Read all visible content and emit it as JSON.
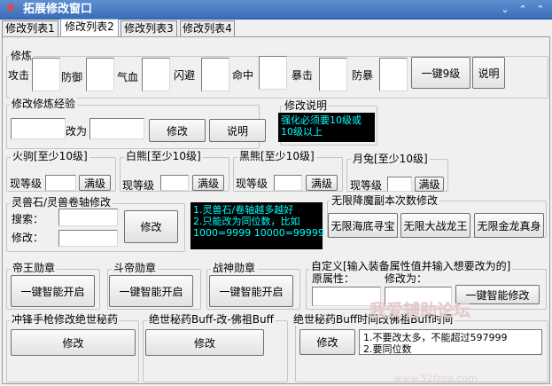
{
  "window": {
    "title": "拓展修改窗口",
    "icon": "dragon-icon"
  },
  "tabs": [
    "修改列表1",
    "修改列表2",
    "修改列表3",
    "修改列表4"
  ],
  "xiulian": {
    "title": "修炼",
    "attack": "攻击",
    "defense": "防御",
    "hp": "气血",
    "dodge": "闪避",
    "hit": "命中",
    "crit": "暴击",
    "critdef": "防暴",
    "max_button": "一键9级",
    "help_button": "说明"
  },
  "exp": {
    "title": "修改修炼经验",
    "to": "改为",
    "modify_button": "修改",
    "help_button": "说明"
  },
  "modify_note": {
    "title": "修改说明",
    "lines": [
      "强化必须要10级或",
      "10级以上"
    ]
  },
  "pets": [
    {
      "title": "火驹[至少10级]",
      "cur": "现等级",
      "max_button": "满级"
    },
    {
      "title": "白熊[至少10级]",
      "cur": "现等级",
      "max_button": "满级"
    },
    {
      "title": "黑熊[至少10级]",
      "cur": "现等级",
      "max_button": "满级"
    },
    {
      "title": "月兔[至少10级]",
      "cur": "现等级",
      "max_button": "满级"
    }
  ],
  "stone": {
    "title": "灵兽石/灵兽卷轴修改",
    "search": "搜索：",
    "modify": "修改：",
    "modify_button": "修改",
    "note_lines": [
      "1.灵兽石/卷轴越多越好",
      "2.只能改为同位数，比如",
      "1000=9999 10000=99999"
    ]
  },
  "infinite": {
    "title": "无限降魔副本次数修改",
    "buttons": [
      "无限海底寻宝",
      "无限大战龙王",
      "无限金龙真身"
    ]
  },
  "medals": [
    {
      "title": "帝王勋章",
      "button": "一键智能开启"
    },
    {
      "title": "斗帝勋章",
      "button": "一键智能开启"
    },
    {
      "title": "战神勋章",
      "button": "一键智能开启"
    }
  ],
  "custom": {
    "title": "自定义[输入装备属性值并输入想要改为的]",
    "orig": "原属性：",
    "to": "修改为：",
    "button": "一键智能修改"
  },
  "secrets": [
    {
      "title": "冲锋手枪修改绝世秘药",
      "button": "修改"
    },
    {
      "title": "绝世秘药Buff-改-佛祖Buff",
      "button": "修改"
    }
  ],
  "buff": {
    "title": "绝世秘药Buff时间改佛祖Buff时间",
    "button": "修改",
    "note_lines": [
      "1.不要改太多，不能超过597999",
      "2.要同位数"
    ]
  },
  "watermark": {
    "text": "我爱辅助论坛",
    "url": "www.52fzba.com"
  }
}
